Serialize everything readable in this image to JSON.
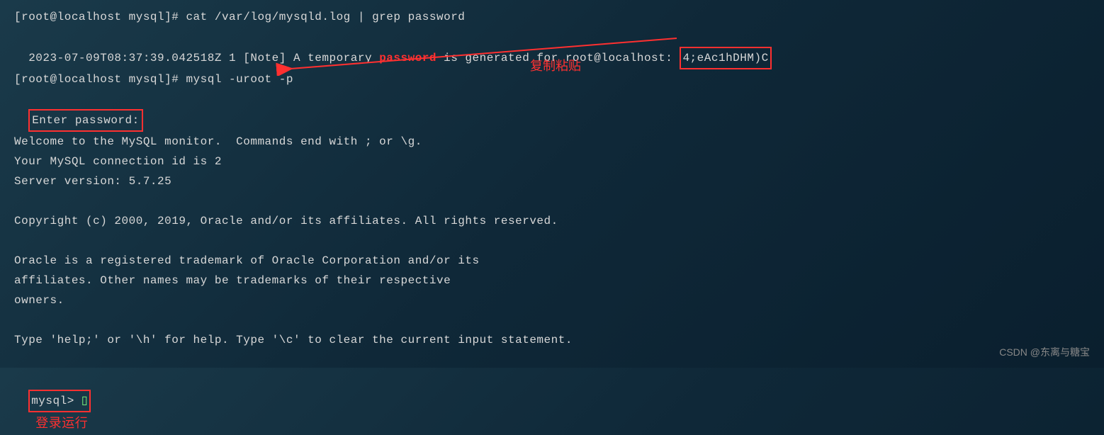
{
  "lines": {
    "prompt1": "[root@localhost mysql]# cat /var/log/mysqld.log | grep password",
    "log_prefix": "2023-07-09T08:37:39.042518Z 1 [Note] A temporary ",
    "log_password_word": "password",
    "log_middle": " is generated for root@localhost: ",
    "temp_password": "4;eAc1hDHM)C",
    "prompt2": "[root@localhost mysql]# mysql -uroot -p",
    "enter_password": "Enter password:",
    "welcome": "Welcome to the MySQL monitor.  Commands end with ; or \\g.",
    "conn_id": "Your MySQL connection id is 2",
    "server_version": "Server version: 5.7.25",
    "blank1": "",
    "copyright": "Copyright (c) 2000, 2019, Oracle and/or its affiliates. All rights reserved.",
    "blank2": "",
    "trademark1": "Oracle is a registered trademark of Oracle Corporation and/or its",
    "trademark2": "affiliates. Other names may be trademarks of their respective",
    "trademark3": "owners.",
    "blank3": "",
    "help_line": "Type 'help;' or '\\h' for help. Type '\\c' to clear the current input statement.",
    "blank4": "",
    "mysql_prompt": "mysql> ",
    "cursor_char": "▯"
  },
  "annotations": {
    "copy_paste": "复制粘贴",
    "login_run": "登录运行"
  },
  "watermark": "CSDN @东离与糖宝"
}
